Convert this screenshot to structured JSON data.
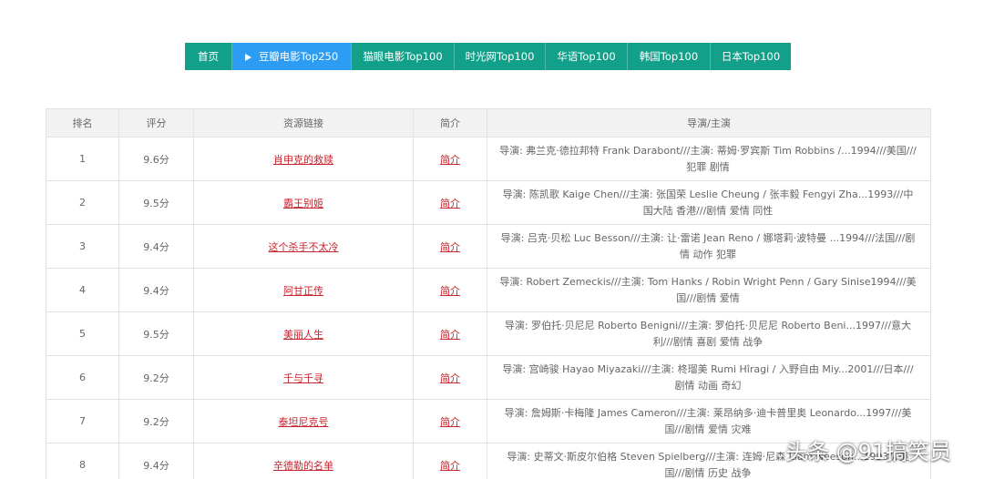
{
  "nav": {
    "items": [
      {
        "label": "首页"
      },
      {
        "label": "豆瓣电影Top250",
        "active": true
      },
      {
        "label": "猫眼电影Top100"
      },
      {
        "label": "时光网Top100"
      },
      {
        "label": "华语Top100"
      },
      {
        "label": "韩国Top100"
      },
      {
        "label": "日本Top100"
      }
    ]
  },
  "table": {
    "headers": [
      "排名",
      "评分",
      "资源链接",
      "简介",
      "导演/主演"
    ],
    "rows": [
      {
        "rank": "1",
        "score": "9.6分",
        "title": "肖申克的救赎",
        "intro": "简介",
        "info": "导演: 弗兰克·德拉邦特 Frank Darabont///主演: 蒂姆·罗宾斯 Tim Robbins /...1994///美国///犯罪 剧情"
      },
      {
        "rank": "2",
        "score": "9.5分",
        "title": "霸王别姬",
        "intro": "简介",
        "info": "导演: 陈凯歌 Kaige Chen///主演: 张国荣 Leslie Cheung / 张丰毅 Fengyi Zha...1993///中国大陆 香港///剧情 爱情 同性"
      },
      {
        "rank": "3",
        "score": "9.4分",
        "title": "这个杀手不太冷",
        "intro": "简介",
        "info": "导演: 吕克·贝松 Luc Besson///主演: 让·雷诺 Jean Reno / 娜塔莉·波特曼 ...1994///法国///剧情 动作 犯罪"
      },
      {
        "rank": "4",
        "score": "9.4分",
        "title": "阿甘正传",
        "intro": "简介",
        "info": "导演: Robert Zemeckis///主演: Tom Hanks / Robin Wright Penn / Gary Sinise1994///美国///剧情 爱情"
      },
      {
        "rank": "5",
        "score": "9.5分",
        "title": "美丽人生",
        "intro": "简介",
        "info": "导演: 罗伯托·贝尼尼 Roberto Benigni///主演: 罗伯托·贝尼尼 Roberto Beni...1997///意大利///剧情 喜剧 爱情 战争"
      },
      {
        "rank": "6",
        "score": "9.2分",
        "title": "千与千寻",
        "intro": "简介",
        "info": "导演: 宫崎骏 Hayao Miyazaki///主演: 柊瑠美 Rumi Hîragi / 入野自由 Miy...2001///日本///剧情 动画 奇幻"
      },
      {
        "rank": "7",
        "score": "9.2分",
        "title": "泰坦尼克号",
        "intro": "简介",
        "info": "导演: 詹姆斯·卡梅隆 James Cameron///主演: 莱昂纳多·迪卡普里奥 Leonardo...1997///美国///剧情 爱情 灾难"
      },
      {
        "rank": "8",
        "score": "9.4分",
        "title": "辛德勒的名单",
        "intro": "简介",
        "info": "导演: 史蒂文·斯皮尔伯格 Steven Spielberg///主演: 连姆·尼森 Liam Neeson...1993///美国///剧情 历史 战争"
      }
    ]
  },
  "watermark": "头条 @91搞笑员"
}
